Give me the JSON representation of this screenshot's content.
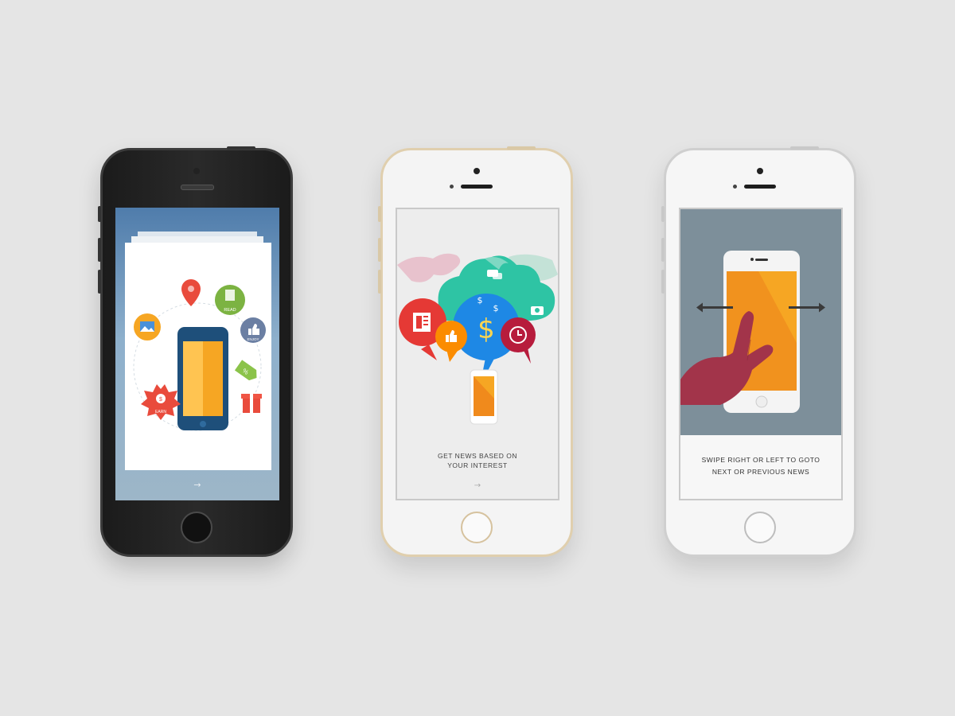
{
  "phones": [
    {
      "finish": "space-gray",
      "screen": {
        "illustration": "phone-app-features",
        "badges": [
          "READ",
          "ENJOY",
          "EARN"
        ],
        "next_arrow": "→"
      }
    },
    {
      "finish": "gold",
      "screen": {
        "illustration": "world-news-bubbles",
        "caption_line1": "GET NEWS BASED ON",
        "caption_line2": "YOUR INTEREST",
        "next_arrow": "→"
      }
    },
    {
      "finish": "silver",
      "screen": {
        "illustration": "swipe-gesture",
        "caption_line1": "SWIPE RIGHT OR LEFT TO GOTO",
        "caption_line2": "NEXT OR PREVIOUS NEWS"
      }
    }
  ],
  "colors": {
    "background": "#e5e5e5",
    "accent_orange": "#f6a623",
    "accent_red": "#e94b3c",
    "accent_green": "#7cb342",
    "accent_blue": "#2a8bd6",
    "hand": "#a2344a"
  }
}
